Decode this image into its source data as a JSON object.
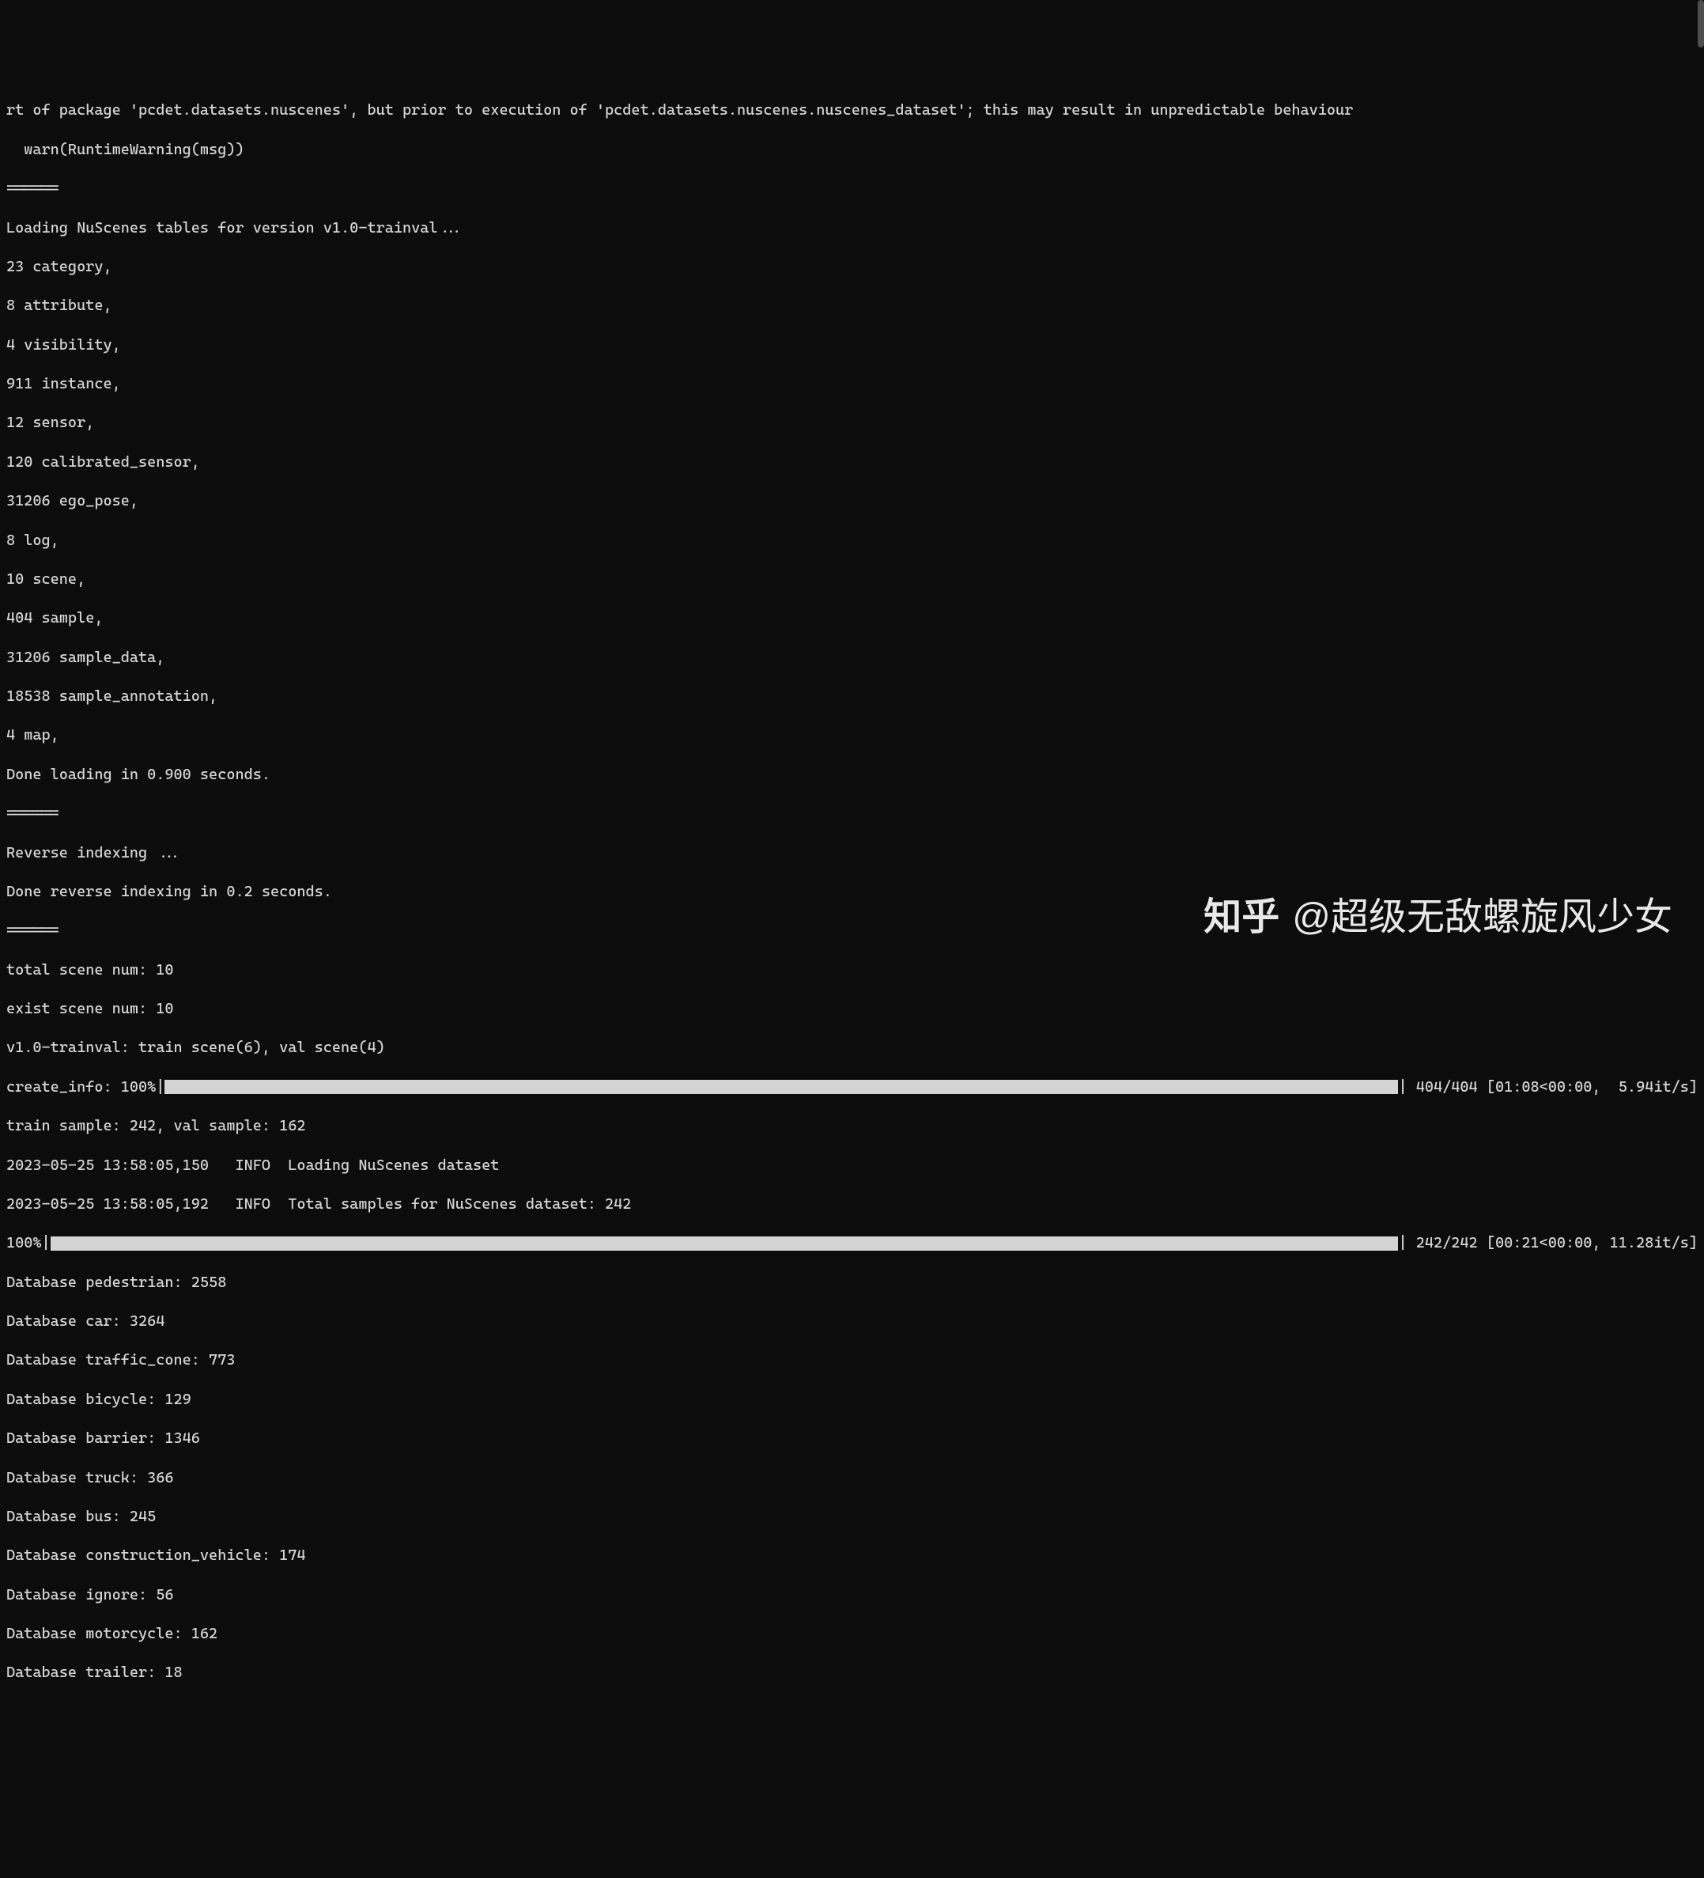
{
  "lines": {
    "warning1": "rt of package 'pcdet.datasets.nuscenes', but prior to execution of 'pcdet.datasets.nuscenes.nuscenes_dataset'; this may result in unpredictable behaviour",
    "warning2": "  warn(RuntimeWarning(msg))",
    "sep1": "======",
    "loading": "Loading NuScenes tables for version v1.0-trainval...",
    "category": "23 category,",
    "attribute": "8 attribute,",
    "visibility": "4 visibility,",
    "instance": "911 instance,",
    "sensor": "12 sensor,",
    "calibrated_sensor": "120 calibrated_sensor,",
    "ego_pose": "31206 ego_pose,",
    "log": "8 log,",
    "scene": "10 scene,",
    "sample": "404 sample,",
    "sample_data": "31206 sample_data,",
    "sample_annotation": "18538 sample_annotation,",
    "map": "4 map,",
    "done_loading": "Done loading in 0.900 seconds.",
    "sep2": "======",
    "reverse_indexing": "Reverse indexing ...",
    "done_reverse": "Done reverse indexing in 0.2 seconds.",
    "sep3": "======",
    "total_scene": "total scene num: 10",
    "exist_scene": "exist scene num: 10",
    "trainval_split": "v1.0-trainval: train scene(6), val scene(4)",
    "train_val_sample": "train sample: 242, val sample: 162",
    "info_loading": "2023-05-25 13:58:05,150   INFO  Loading NuScenes dataset",
    "info_total": "2023-05-25 13:58:05,192   INFO  Total samples for NuScenes dataset: 242",
    "db_pedestrian": "Database pedestrian: 2558",
    "db_car": "Database car: 3264",
    "db_traffic_cone": "Database traffic_cone: 773",
    "db_bicycle": "Database bicycle: 129",
    "db_barrier": "Database barrier: 1346",
    "db_truck": "Database truck: 366",
    "db_bus": "Database bus: 245",
    "db_construction": "Database construction_vehicle: 174",
    "db_ignore": "Database ignore: 56",
    "db_motorcycle": "Database motorcycle: 162",
    "db_trailer": "Database trailer: 18"
  },
  "progress1": {
    "label": "create_info: 100%|",
    "end_char": "|",
    "stats": " 404/404 [01:08<00:00,  5.94it/s]"
  },
  "progress2": {
    "label": "100%|",
    "end_char": "|",
    "stats": " 242/242 [00:21<00:00, 11.28it/s]"
  },
  "watermark": {
    "logo": "知乎",
    "text": "@超级无敌螺旋风少女"
  }
}
